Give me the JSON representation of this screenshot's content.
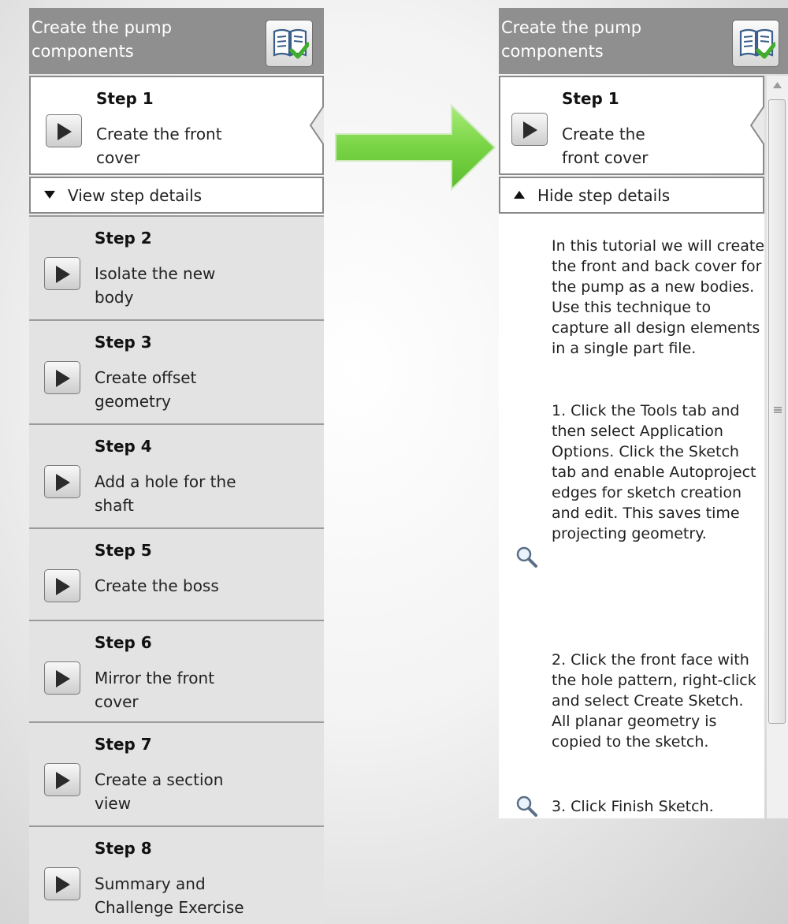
{
  "left_panel": {
    "title": "Create the pump components",
    "toggle_label": "View step details",
    "steps": [
      {
        "number": "Step 1",
        "text": "Create the front cover"
      },
      {
        "number": "Step 2",
        "text": "Isolate the new body"
      },
      {
        "number": "Step 3",
        "text": "Create offset geometry"
      },
      {
        "number": "Step 4",
        "text": "Add a hole for the shaft"
      },
      {
        "number": "Step 5",
        "text": "Create the boss"
      },
      {
        "number": "Step 6",
        "text": "Mirror the front cover"
      },
      {
        "number": "Step 7",
        "text": "Create a section view"
      },
      {
        "number": "Step 8",
        "text": "Summary and Challenge Exercise"
      }
    ]
  },
  "right_panel": {
    "title": "Create the pump components",
    "step": {
      "number": "Step 1",
      "text": "Create the front cover"
    },
    "toggle_label": "Hide step details",
    "details": [
      "In this tutorial we will create the front and back cover for the pump as a new bodies. Use this technique to capture all design elements in a single part file.",
      "1. Click the Tools tab and then select Application Options. Click the Sketch tab and enable Autoproject edges for sketch creation and edit. This saves time projecting geometry.",
      "2. Click the front face with the hole pattern, right-click and select Create Sketch. All planar geometry is copied to the sketch.",
      "3. Click Finish Sketch."
    ]
  },
  "colors": {
    "header_gray": "#8f8f8f",
    "card_gray": "#e3e3e3",
    "arrow_green": "#7dd84a",
    "check_green": "#3fae2a"
  },
  "icons": {
    "book": "book-check-icon",
    "play": "play-icon",
    "zoom": "magnifier-icon",
    "arrow": "right-arrow-icon"
  }
}
